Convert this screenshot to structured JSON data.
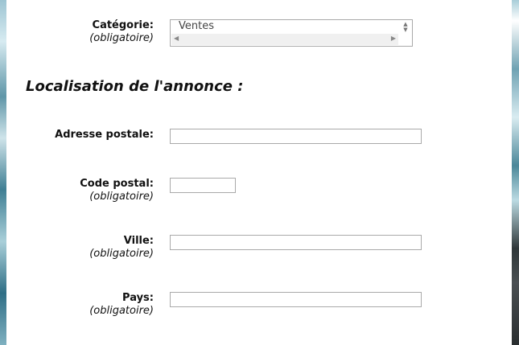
{
  "category": {
    "label": "Catégorie:",
    "required": "(obligatoire)",
    "selected_value": "Ventes"
  },
  "location_section": {
    "title": "Localisation de l'annonce :"
  },
  "fields": {
    "address": {
      "label": "Adresse postale:",
      "value": ""
    },
    "postal_code": {
      "label": "Code postal:",
      "required": "(obligatoire)",
      "value": ""
    },
    "city": {
      "label": "Ville:",
      "required": "(obligatoire)",
      "value": ""
    },
    "country": {
      "label": "Pays:",
      "required": "(obligatoire)",
      "value": ""
    }
  },
  "icons": {
    "spinner": "up-down-arrows-icon",
    "scroll_left": "chevron-left-icon",
    "scroll_right": "chevron-right-icon"
  }
}
